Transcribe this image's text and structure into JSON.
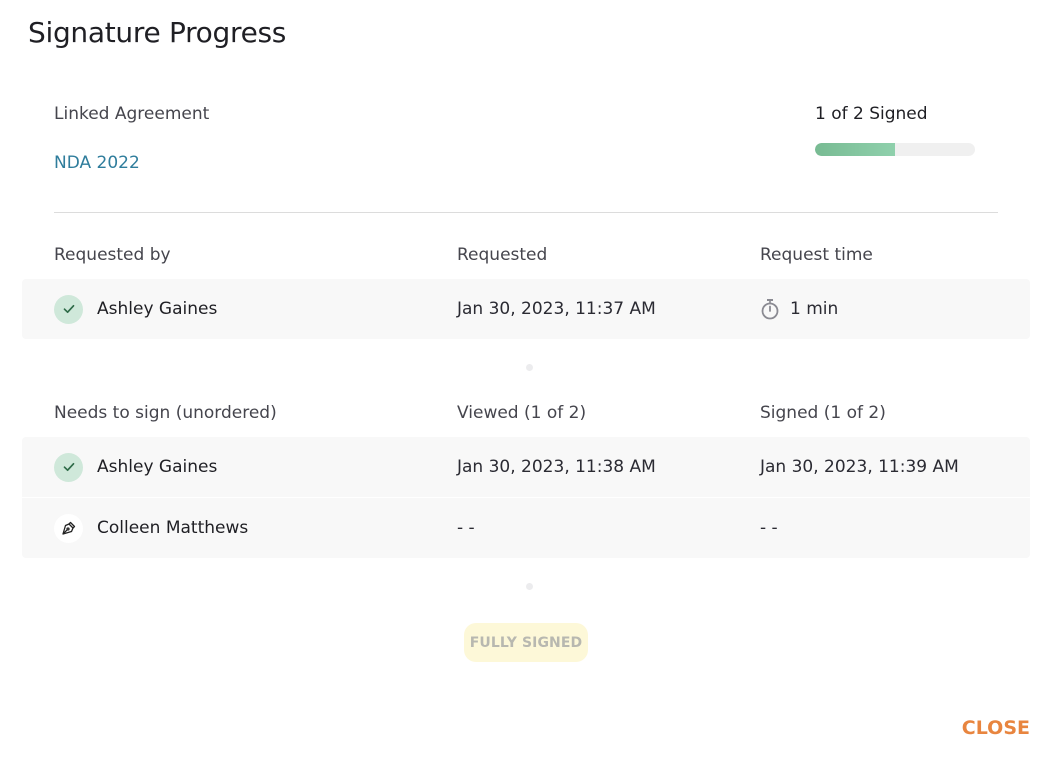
{
  "dialog": {
    "title": "Signature Progress",
    "close_label": "CLOSE"
  },
  "agreement": {
    "label": "Linked Agreement",
    "link_text": "NDA 2022"
  },
  "progress": {
    "label": "1 of 2 Signed",
    "signed": 1,
    "total": 2,
    "fraction": 0.5,
    "fill_color": "#7fc49c"
  },
  "request_section": {
    "headers": [
      "Requested by",
      "Requested",
      "Request time"
    ],
    "rows": [
      {
        "status_icon": "check-icon",
        "name": "Ashley Gaines",
        "requested": "Jan 30, 2023, 11:37 AM",
        "time_icon": "stopwatch-icon",
        "request_time": "1 min"
      }
    ]
  },
  "signers_section": {
    "headers": [
      "Needs to sign (unordered)",
      "Viewed (1 of 2)",
      "Signed (1 of 2)"
    ],
    "rows": [
      {
        "status_icon": "check-icon",
        "name": "Ashley Gaines",
        "viewed": "Jan 30, 2023, 11:38 AM",
        "signed": "Jan 30, 2023, 11:39 AM"
      },
      {
        "status_icon": "pen-nib-icon",
        "name": "Colleen Matthews",
        "viewed": "- -",
        "signed": "- -"
      }
    ]
  },
  "status_badge": {
    "label": "FULLY SIGNED"
  },
  "colors": {
    "link": "#2f7d9c",
    "close": "#e8853f",
    "check_bg": "#cfe8da",
    "check": "#2e6b48",
    "badge_bg": "#fdf8d8"
  }
}
